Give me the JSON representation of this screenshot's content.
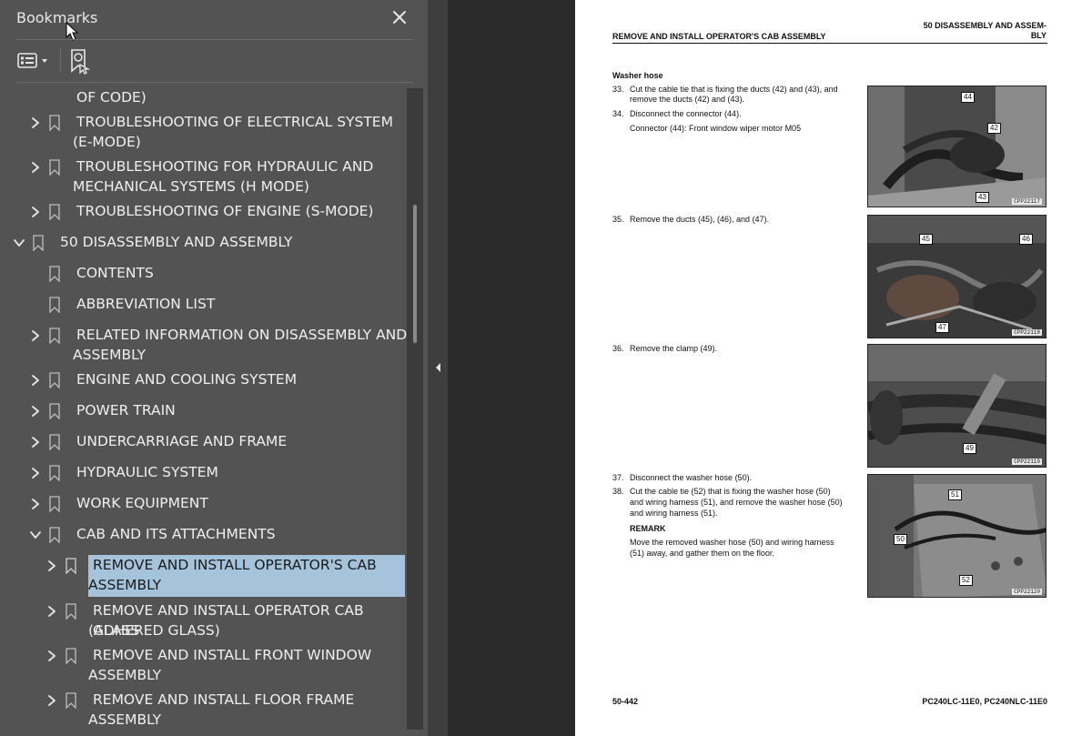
{
  "sidebar": {
    "title": "Bookmarks",
    "close_icon": "close-icon",
    "options_icon": "list-options-icon",
    "add_bookmark_icon": "bookmark-add-icon",
    "colors": {
      "panel": "#535353",
      "selected": "#a5c4dc",
      "text": "#efefef"
    },
    "nodes": [
      {
        "label_lines": [
          "OF CODE)"
        ],
        "expander": "none",
        "bookmark": false
      },
      {
        "label_lines": [
          "TROUBLESHOOTING OF ELECTRICAL SYSTEM",
          "(E-MODE)"
        ],
        "expander": "collapsed"
      },
      {
        "label_lines": [
          "TROUBLESHOOTING FOR HYDRAULIC AND",
          "MECHANICAL SYSTEMS (H MODE)"
        ],
        "expander": "collapsed"
      },
      {
        "label_lines": [
          "TROUBLESHOOTING OF ENGINE (S-MODE)"
        ],
        "expander": "collapsed"
      },
      {
        "label_lines": [
          "50 DISASSEMBLY AND ASSEMBLY"
        ],
        "expander": "expanded"
      },
      {
        "label_lines": [
          "CONTENTS"
        ],
        "expander": "none"
      },
      {
        "label_lines": [
          "ABBREVIATION LIST"
        ],
        "expander": "none"
      },
      {
        "label_lines": [
          "RELATED INFORMATION ON DISASSEMBLY AND",
          "ASSEMBLY"
        ],
        "expander": "collapsed"
      },
      {
        "label_lines": [
          "ENGINE AND COOLING SYSTEM"
        ],
        "expander": "collapsed"
      },
      {
        "label_lines": [
          "POWER TRAIN"
        ],
        "expander": "collapsed"
      },
      {
        "label_lines": [
          "UNDERCARRIAGE AND FRAME"
        ],
        "expander": "collapsed"
      },
      {
        "label_lines": [
          "HYDRAULIC SYSTEM"
        ],
        "expander": "collapsed"
      },
      {
        "label_lines": [
          "WORK EQUIPMENT"
        ],
        "expander": "collapsed"
      },
      {
        "label_lines": [
          "CAB AND ITS ATTACHMENTS"
        ],
        "expander": "expanded"
      },
      {
        "label_lines": [
          "REMOVE AND INSTALL OPERATOR'S CAB",
          "ASSEMBLY"
        ],
        "expander": "collapsed",
        "selected": true
      },
      {
        "label_lines": [
          "REMOVE AND INSTALL OPERATOR CAB GLASS",
          "(ADHERED GLASS)"
        ],
        "expander": "collapsed"
      },
      {
        "label_lines": [
          "REMOVE AND INSTALL FRONT WINDOW",
          "ASSEMBLY"
        ],
        "expander": "collapsed"
      },
      {
        "label_lines": [
          "REMOVE AND INSTALL FLOOR FRAME",
          "ASSEMBLY"
        ],
        "expander": "collapsed"
      }
    ]
  },
  "page": {
    "header_left": "REMOVE AND INSTALL OPERATOR'S CAB ASSEMBLY",
    "header_right_1": "50 DISASSEMBLY AND ASSEM-",
    "header_right_2": "BLY",
    "section_title": "Washer hose",
    "steps": {
      "s33_num": "33.",
      "s33_l1": "Cut the cable tie that is fixing the ducts (42) and (43), and",
      "s33_l2": "remove the ducts (42) and (43).",
      "s34_num": "34.",
      "s34_l1": "Disconnect the connector (44).",
      "s34_note": "Connector (44): Front window wiper motor M05",
      "s35_num": "35.",
      "s35_l1": "Remove the ducts (45), (46), and (47).",
      "s36_num": "36.",
      "s36_l1": "Remove the clamp (49).",
      "s37_num": "37.",
      "s37_l1": "Disconnect the washer hose (50).",
      "s38_num": "38.",
      "s38_l1": "Cut the cable tie (52) that is fixing the washer hose (50)",
      "s38_l2": "and wiring harness (51), and remove the washer hose (50)",
      "s38_l3": "and wiring harness (51).",
      "remark_title": "REMARK",
      "remark_l1": "Move the removed washer hose (50) and wiring harness",
      "remark_l2": "(51) away, and gather them on the floor."
    },
    "figures": [
      {
        "code": "CPP22117",
        "callouts": [
          "44",
          "42",
          "43"
        ]
      },
      {
        "code": "CPP22118",
        "callouts": [
          "45",
          "46",
          "47"
        ]
      },
      {
        "code": "CPP22119",
        "callouts": [
          "49"
        ]
      },
      {
        "code": "CPP22120",
        "callouts": [
          "51",
          "50",
          "52"
        ]
      }
    ],
    "footer_left": "50-442",
    "footer_right": "PC240LC-11E0, PC240NLC-11E0"
  }
}
